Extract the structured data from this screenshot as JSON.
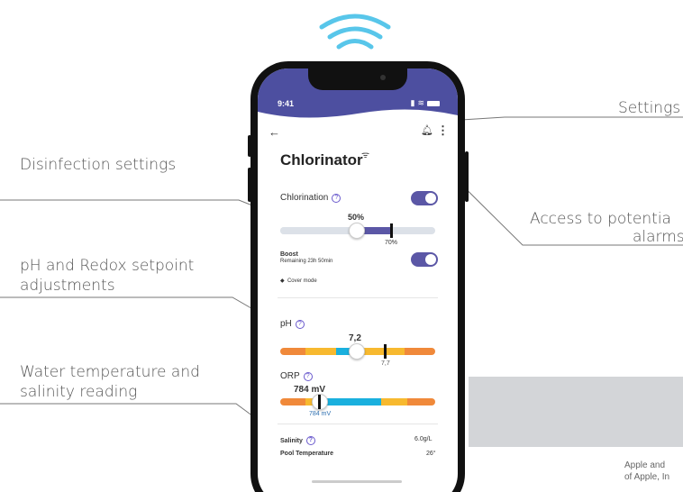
{
  "callouts": {
    "disinfection": "Disinfection settings",
    "ph_redox_line1": "pH and Redox setpoint",
    "ph_redox_line2": "adjustments",
    "water_line1": "Water temperature and",
    "water_line2": "salinity reading",
    "settings": "Settings",
    "alarms_line1": "Access to potentia",
    "alarms_line2": "alarms"
  },
  "footnote": {
    "line1": "Apple and",
    "line2": "of Apple, In"
  },
  "status_bar": {
    "time": "9:41"
  },
  "app": {
    "title": "Chlorinator",
    "chlorination": {
      "label": "Chlorination",
      "value_label": "50%",
      "value": 0.5,
      "max_label": "70%",
      "max": 0.7,
      "enabled": true
    },
    "boost": {
      "label": "Boost",
      "remaining": "Remaining 23h 50min",
      "enabled": true
    },
    "cover_mode": "Cover mode",
    "ph": {
      "label": "pH",
      "value_label": "7,2",
      "setpoint_label": "7,7"
    },
    "orp": {
      "label": "ORP",
      "value_label": "784 mV",
      "setpoint_label": "784 mV"
    },
    "salinity": {
      "label": "Salinity",
      "value": "6.0g/L"
    },
    "pool_temperature": {
      "label": "Pool Temperature",
      "value": "26°"
    }
  },
  "colors": {
    "accent": "#5b57a6",
    "header": "#4d4fa0",
    "orange": "#f0893a",
    "yellow": "#f7b92f",
    "blue": "#1ab0de",
    "wifi": "#58c6ea"
  }
}
